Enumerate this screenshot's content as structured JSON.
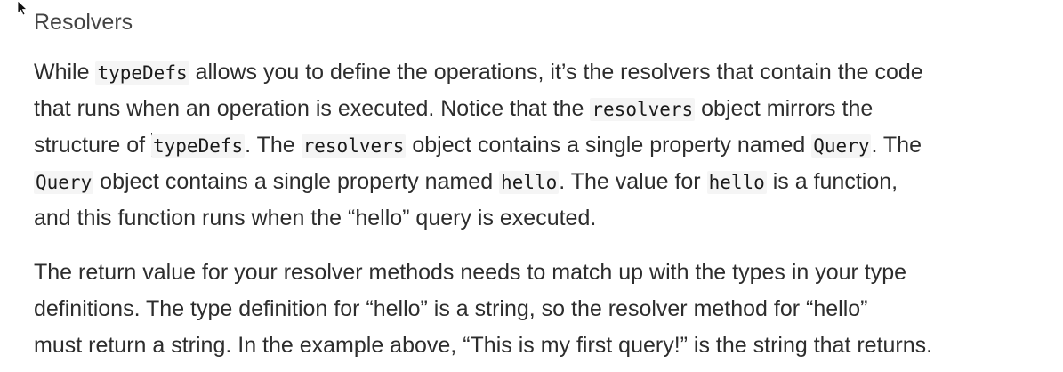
{
  "heading": "Resolvers",
  "paragraph1": {
    "line1": {
      "a": "While ",
      "code1": "typeDefs",
      "b": " allows you to define the operations, it’s the resolvers that contain the code"
    },
    "line2": {
      "a": "that runs when an operation is executed. Notice that the ",
      "code1": "resolvers",
      "b": " object mirrors the"
    },
    "line3": {
      "a": "structure of ",
      "code1": "typeDefs",
      "b": ". The ",
      "code2": "resolvers",
      "c": " object contains a single property named ",
      "code3": "Query",
      "d": ". The"
    },
    "line4": {
      "code1": "Query",
      "a": " object contains a single property named ",
      "code2": "hello",
      "b": ". The value for ",
      "code3": "hello",
      "c": " is a function,"
    },
    "line5": {
      "a": "and this function runs when the “hello” query is executed."
    }
  },
  "paragraph2": {
    "line1": "The return value for your resolver methods needs to match up with the types in your type",
    "line2": "definitions. The type definition for “hello” is a string, so the resolver method for “hello”",
    "line3": "must return a string. In the example above, “This is my first query!” is the string that returns."
  }
}
